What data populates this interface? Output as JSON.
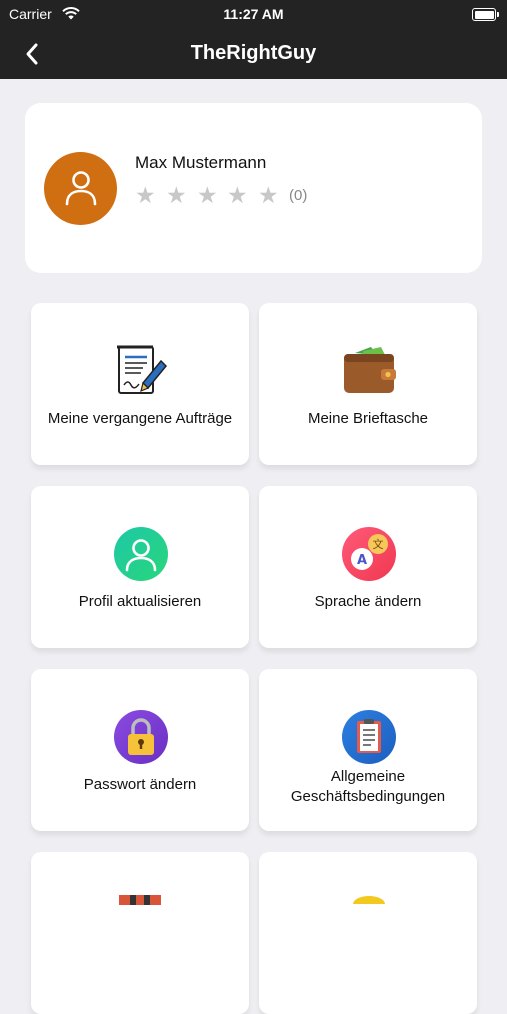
{
  "status_bar": {
    "carrier": "Carrier",
    "time": "11:27 AM"
  },
  "nav": {
    "title": "TheRightGuy"
  },
  "profile": {
    "name": "Max Mustermann",
    "rating": 0,
    "rating_max": 5,
    "rating_count": "(0)",
    "avatar_color": "#d06e12"
  },
  "menu": [
    {
      "label": "Meine vergangene Aufträge",
      "icon": "contract-icon"
    },
    {
      "label": "Meine Brieftasche",
      "icon": "wallet-icon"
    },
    {
      "label": "Profil aktualisieren",
      "icon": "user-icon"
    },
    {
      "label": "Sprache ändern",
      "icon": "translate-icon"
    },
    {
      "label": "Passwort ändern",
      "icon": "lock-icon"
    },
    {
      "label": "Allgemeine Geschäftsbedingungen",
      "icon": "clipboard-icon"
    }
  ],
  "colors": {
    "nav_background": "#232323",
    "page_background": "#efeff3"
  }
}
